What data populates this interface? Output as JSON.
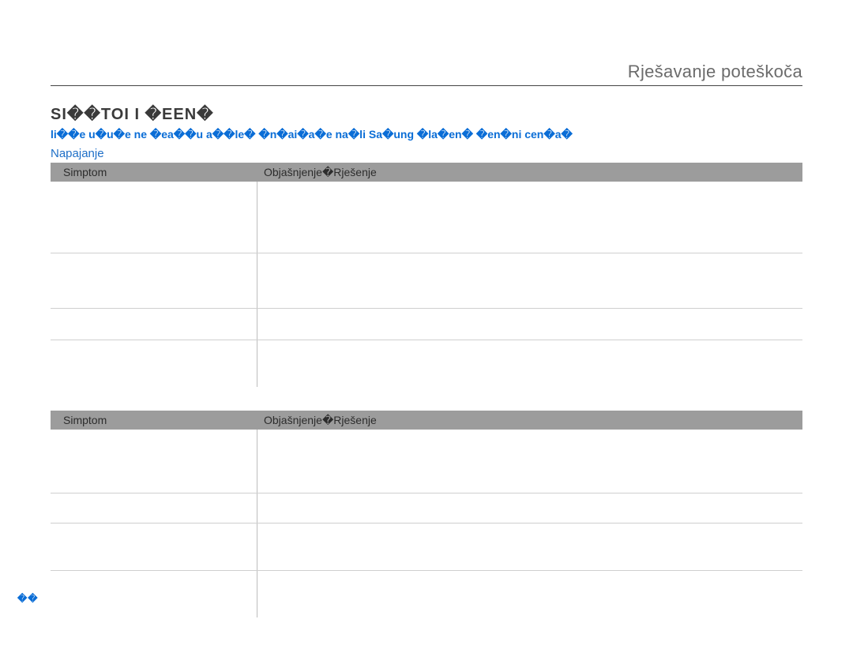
{
  "header": {
    "title": "Rješavanje poteškoča"
  },
  "section_title": "SI��TOI I �EEN�",
  "intro_blue": "li��e u�u�e ne �ea��u a��le� �n�ai�a�e na�li Sa�ung �la�en� �en�ni cen�a�",
  "sub_blue": "Napajanje",
  "table1": {
    "header_left": "Simptom",
    "header_right": "Objašnjenje�Rješenje"
  },
  "table2": {
    "header_left": "Simptom",
    "header_right": "Objašnjenje�Rješenje"
  },
  "page_number": "��"
}
